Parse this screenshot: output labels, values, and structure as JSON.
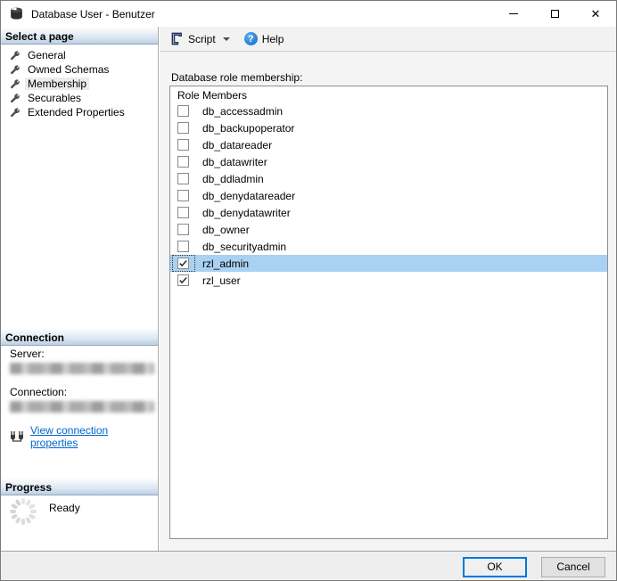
{
  "window": {
    "title": "Database User - Benutzer"
  },
  "sidebar": {
    "select_header": "Select a page",
    "pages": [
      {
        "label": "General",
        "selected": false
      },
      {
        "label": "Owned Schemas",
        "selected": false
      },
      {
        "label": "Membership",
        "selected": true
      },
      {
        "label": "Securables",
        "selected": false
      },
      {
        "label": "Extended Properties",
        "selected": false
      }
    ],
    "connection_header": "Connection",
    "server_label": "Server:",
    "connection_label": "Connection:",
    "view_link_label": "View connection properties",
    "progress_header": "Progress",
    "progress_status": "Ready"
  },
  "toolbar": {
    "script_label": "Script",
    "help_label": "Help"
  },
  "main": {
    "membership_label": "Database role membership:",
    "list_header": "Role Members",
    "roles": [
      {
        "name": "db_accessadmin",
        "checked": false,
        "selected": false
      },
      {
        "name": "db_backupoperator",
        "checked": false,
        "selected": false
      },
      {
        "name": "db_datareader",
        "checked": false,
        "selected": false
      },
      {
        "name": "db_datawriter",
        "checked": false,
        "selected": false
      },
      {
        "name": "db_ddladmin",
        "checked": false,
        "selected": false
      },
      {
        "name": "db_denydatareader",
        "checked": false,
        "selected": false
      },
      {
        "name": "db_denydatawriter",
        "checked": false,
        "selected": false
      },
      {
        "name": "db_owner",
        "checked": false,
        "selected": false
      },
      {
        "name": "db_securityadmin",
        "checked": false,
        "selected": false
      },
      {
        "name": "rzl_admin",
        "checked": true,
        "selected": true
      },
      {
        "name": "rzl_user",
        "checked": true,
        "selected": false
      }
    ]
  },
  "footer": {
    "ok_label": "OK",
    "cancel_label": "Cancel"
  },
  "colors": {
    "selection_blue": "#a9d1f2",
    "link_blue": "#0066cc",
    "ok_border_blue": "#0078d7",
    "help_blue": "#1565c0"
  }
}
